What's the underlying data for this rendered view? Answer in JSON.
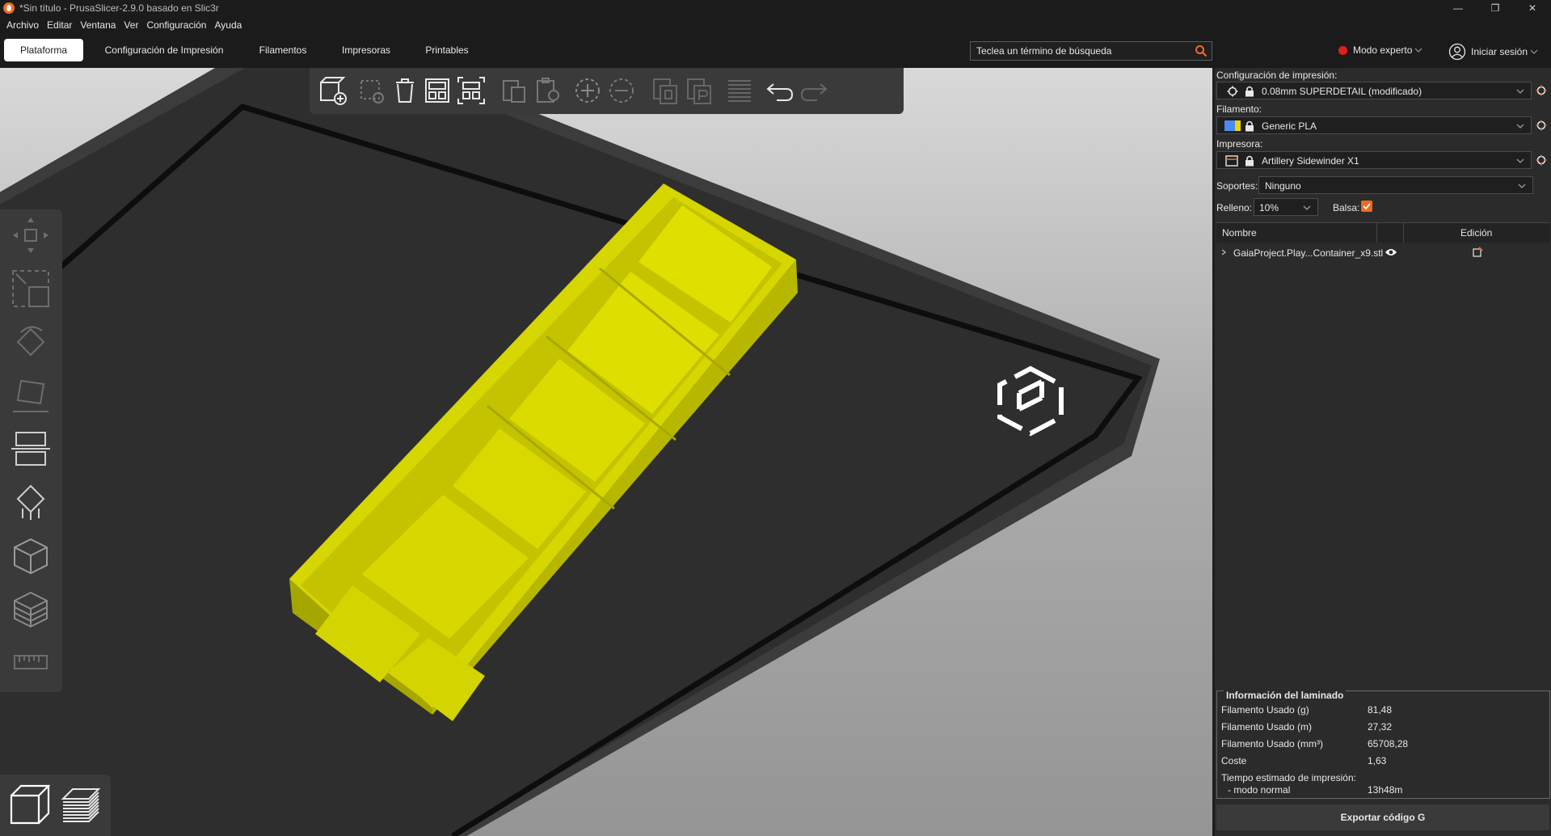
{
  "window": {
    "title": "*Sin título - PrusaSlicer-2.9.0 basado en Slic3r"
  },
  "menu": [
    "Archivo",
    "Editar",
    "Ventana",
    "Ver",
    "Configuración",
    "Ayuda"
  ],
  "tabs": [
    "Plataforma",
    "Configuración de Impresión",
    "Filamentos",
    "Impresoras",
    "Printables"
  ],
  "search": {
    "placeholder": "Teclea un término de búsqueda"
  },
  "mode": {
    "label": "Modo experto",
    "color": "#e41d1d"
  },
  "account": {
    "label": "Iniciar sesión"
  },
  "panel": {
    "print_settings_label": "Configuración de impresión:",
    "print_settings_value": "0.08mm SUPERDETAIL (modificado)",
    "filament_label": "Filamento:",
    "filament_value": "Generic PLA",
    "printer_label": "Impresora:",
    "printer_value": "Artillery Sidewinder X1",
    "supports_label": "Soportes:",
    "supports_value": "Ninguno",
    "infill_label": "Relleno:",
    "infill_value": "10%",
    "brim_label": "Balsa:",
    "brim_checked": true
  },
  "object_list": {
    "col_name": "Nombre",
    "col_edit": "Edición",
    "items": [
      {
        "name": "GaiaProject.Play...Container_x9.stl"
      }
    ]
  },
  "slice_info": {
    "title": "Información del laminado",
    "rows": [
      {
        "label": "Filamento Usado (g)",
        "value": "81,48"
      },
      {
        "label": "Filamento Usado (m)",
        "value": "27,32"
      },
      {
        "label": "Filamento Usado (mm³)",
        "value": "65708,28"
      },
      {
        "label": "Coste",
        "value": "1,63"
      }
    ],
    "time_label": "Tiempo estimado de impresión:",
    "time_mode_label": "- modo normal",
    "time_value": "13h48m"
  },
  "export_button": "Exportar código G",
  "colors": {
    "accent": "#ed6b21",
    "model": "#d6d600",
    "bed": "#2e2e2e"
  }
}
